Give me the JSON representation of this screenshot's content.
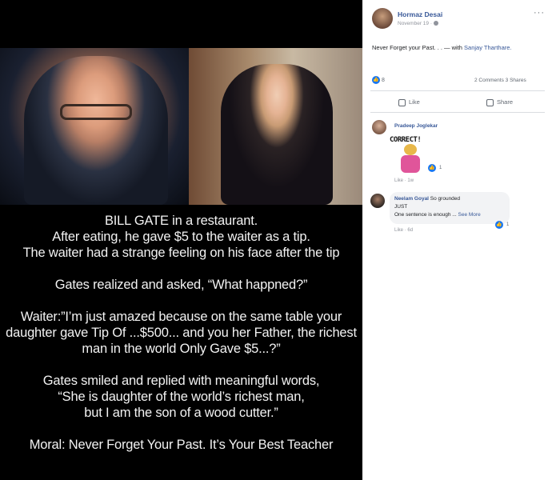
{
  "media": {
    "story": [
      [
        "BILL GATE  in a restaurant.",
        "After eating, he gave $5 to the waiter as a tip.",
        "The waiter had a strange feeling on his face after the tip"
      ],
      [
        "Gates realized and asked, “What happned?”"
      ],
      [
        "Waiter:”I’m just amazed because on the same table your",
        "daughter gave Tip Of ...$500... and you her Father,  the richest",
        "man in the world Only Gave $5...?”"
      ],
      [
        "Gates smiled and replied with meaningful words,",
        "“She is daughter of the world’s richest man,",
        "but I am  the son of a wood cutter.”"
      ],
      [
        "Moral: Never Forget Your Past. It’s Your Best Teacher"
      ]
    ]
  },
  "post": {
    "author": "Hormaz Desai",
    "time": "November 19 ·",
    "more": "···",
    "text": "Never Forget your Past. . . — with ",
    "tagged": "Sanjay Tharthare.",
    "reaction_count": "8",
    "comments": "2 Comments",
    "shares": "3 Shares",
    "like_label": "Like",
    "share_label": "Share"
  },
  "comments": [
    {
      "name": "Pradeep Joglekar",
      "text": "CORRECT!",
      "reactions": "1",
      "like": "Like",
      "age": "1w"
    },
    {
      "name": "Neelam Goyal",
      "text_inline": " So grounded",
      "line2": "JUST",
      "line3": "One sentence is enough ... ",
      "see_more": "See More",
      "reactions": "1",
      "like": "Like",
      "age": "6d"
    }
  ],
  "colors": {
    "link": "#385898",
    "like_blue": "#1877f2",
    "media_bg": "#000000"
  }
}
